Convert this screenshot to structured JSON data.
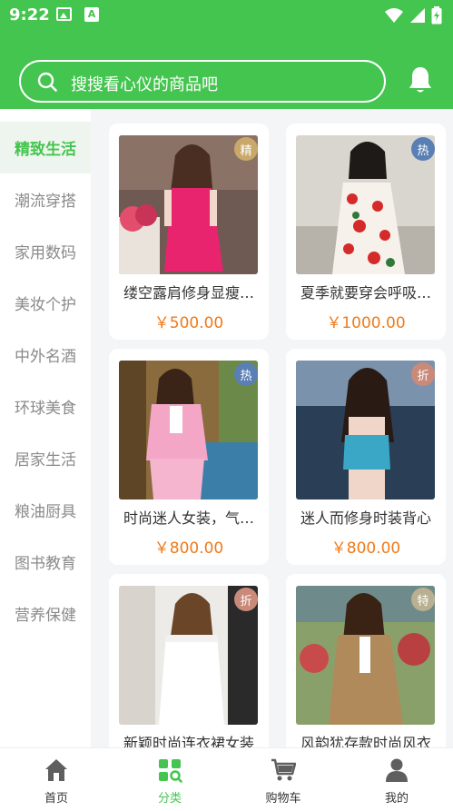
{
  "status_bar": {
    "time": "9:22",
    "a_icon_text": "A"
  },
  "search": {
    "placeholder": "搜搜看心仪的商品吧"
  },
  "sidebar": {
    "categories": [
      {
        "label": "精致生活",
        "active": true
      },
      {
        "label": "潮流穿搭",
        "active": false
      },
      {
        "label": "家用数码",
        "active": false
      },
      {
        "label": "美妆个护",
        "active": false
      },
      {
        "label": "中外名酒",
        "active": false
      },
      {
        "label": "环球美食",
        "active": false
      },
      {
        "label": "居家生活",
        "active": false
      },
      {
        "label": "粮油厨具",
        "active": false
      },
      {
        "label": "图书教育",
        "active": false
      },
      {
        "label": "营养保健",
        "active": false
      }
    ]
  },
  "products": [
    {
      "title": "缕空露肩修身显瘦连衣裙",
      "price": "￥500.00",
      "badge": "精",
      "badge_color": "#c9a86a"
    },
    {
      "title": "夏季就要穿会呼吸的连衣裙",
      "price": "￥1000.00",
      "badge": "热",
      "badge_color": "#5a7fb5"
    },
    {
      "title": "时尚迷人女装，气质套裙",
      "price": "￥800.00",
      "badge": "热",
      "badge_color": "#5a7fb5"
    },
    {
      "title": "迷人而修身时装背心",
      "price": "￥800.00",
      "badge": "折",
      "badge_color": "#c98a7a"
    },
    {
      "title": "新颖时尚连衣裙女装",
      "price": "",
      "badge": "折",
      "badge_color": "#c98a7a"
    },
    {
      "title": "风韵犹存款时尚风衣",
      "price": "",
      "badge": "特",
      "badge_color": "#b8b090"
    }
  ],
  "tabbar": {
    "items": [
      {
        "label": "首页",
        "icon": "home-icon",
        "active": false
      },
      {
        "label": "分类",
        "icon": "category-icon",
        "active": true
      },
      {
        "label": "购物车",
        "icon": "cart-icon",
        "active": false
      },
      {
        "label": "我的",
        "icon": "user-icon",
        "active": false
      }
    ]
  },
  "colors": {
    "accent": "#44c54f",
    "price": "#f07a1a",
    "sidebar_active_bg": "#eef5ee"
  }
}
